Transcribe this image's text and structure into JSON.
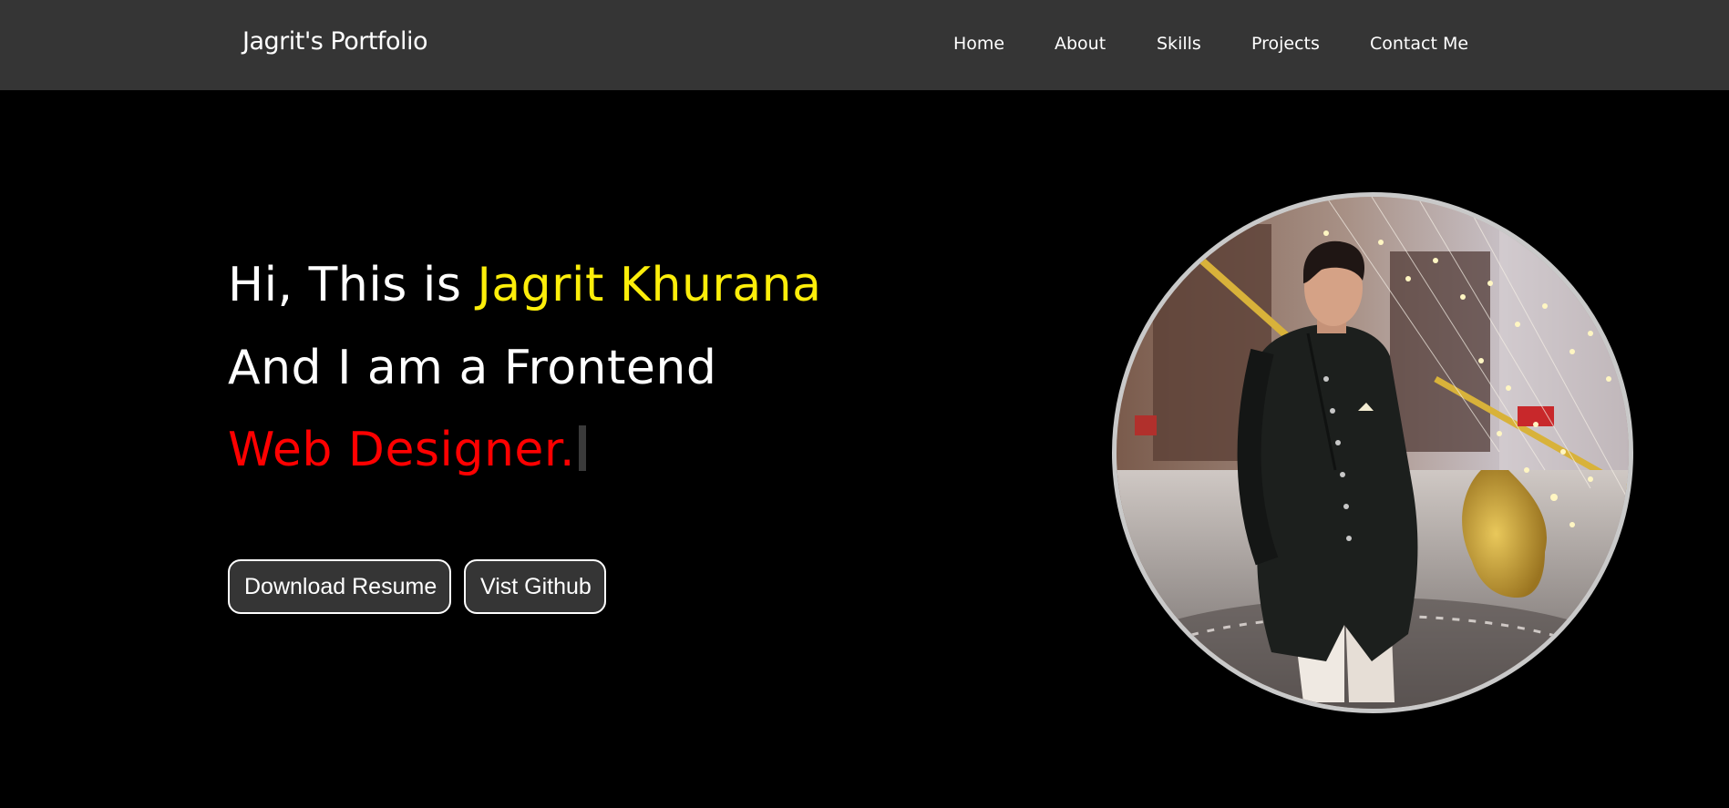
{
  "header": {
    "brand": "Jagrit's Portfolio",
    "nav": [
      "Home",
      "About",
      "Skills",
      "Projects",
      "Contact Me"
    ]
  },
  "hero": {
    "line1_prefix": "Hi, This is ",
    "line1_name": "Jagrit Khurana",
    "line2": "And I am a Frontend",
    "line3": "Web Designer."
  },
  "buttons": {
    "resume": "Download Resume",
    "github": "Vist Github"
  },
  "colors": {
    "navbar": "#353535",
    "background": "#000000",
    "name_highlight": "#fcee0a",
    "role_text": "#ff0000"
  },
  "profile_image": {
    "icon": "profile-photo"
  }
}
